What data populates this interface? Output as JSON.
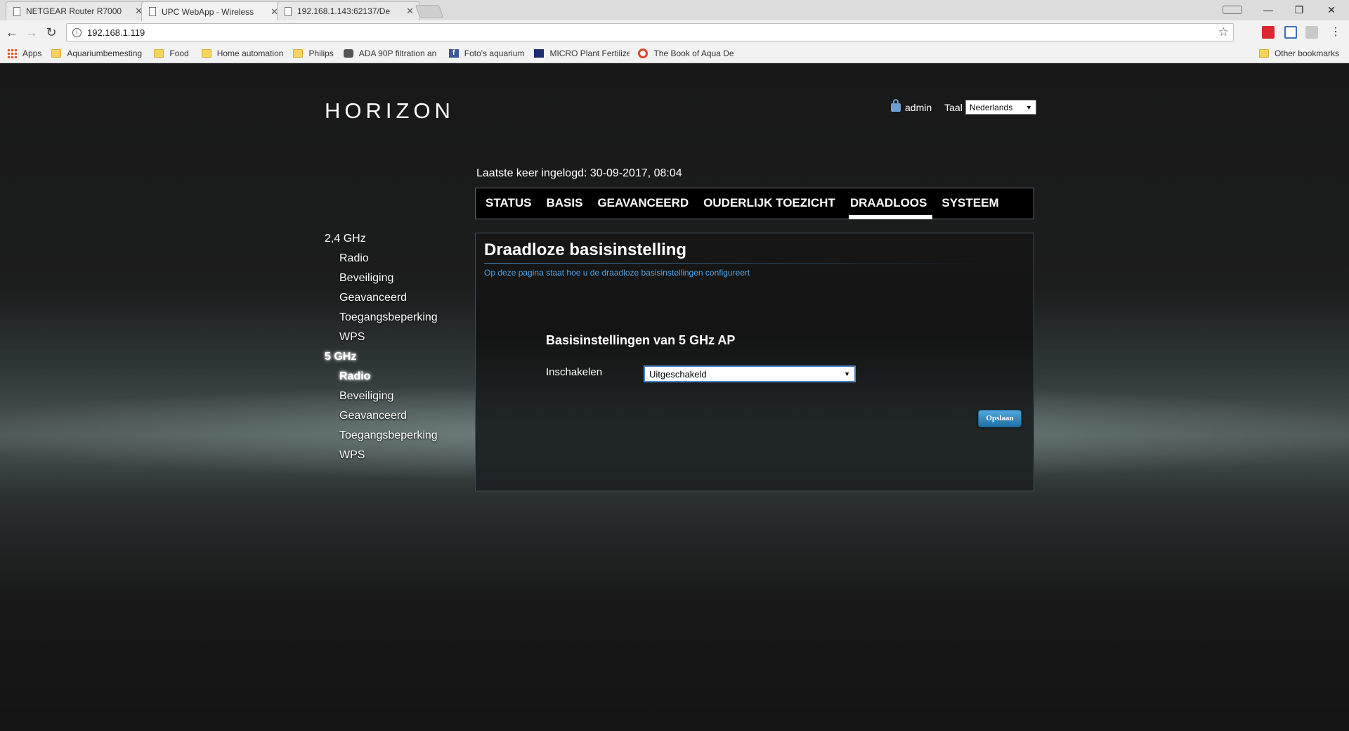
{
  "browser": {
    "tabs": [
      {
        "title": "NETGEAR Router R7000"
      },
      {
        "title": "UPC WebApp - Wireless"
      },
      {
        "title": "192.168.1.143:62137/De"
      }
    ],
    "url": "192.168.1.119",
    "bookmarks": [
      {
        "label": "Apps",
        "icon": "apps-grid-icon"
      },
      {
        "label": "Aquariumbemesting",
        "icon": "folder-icon"
      },
      {
        "label": "Food",
        "icon": "folder-icon"
      },
      {
        "label": "Home automation",
        "icon": "folder-icon"
      },
      {
        "label": "Philips",
        "icon": "folder-icon"
      },
      {
        "label": "ADA 90P filtration an",
        "icon": "ada-icon"
      },
      {
        "label": "Foto's aquarium",
        "icon": "facebook-icon"
      },
      {
        "label": "MICRO Plant Fertilize",
        "icon": "micro-icon"
      },
      {
        "label": "The Book of Aqua De",
        "icon": "book-icon"
      }
    ],
    "other_bookmarks": "Other bookmarks"
  },
  "header": {
    "logo": "HORIZON",
    "user": "admin",
    "language_label": "Taal",
    "language_value": "Nederlands"
  },
  "last_login": "Laatste keer ingelogd: 30-09-2017, 08:04",
  "topnav": {
    "items": [
      "STATUS",
      "BASIS",
      "GEAVANCEERD",
      "OUDERLIJK TOEZICHT",
      "DRAADLOOS",
      "SYSTEEM"
    ],
    "active": "DRAADLOOS"
  },
  "sidenav": {
    "groups": [
      {
        "label": "2,4 GHz",
        "items": [
          "Radio",
          "Beveiliging",
          "Geavanceerd",
          "Toegangsbeperking",
          "WPS"
        ]
      },
      {
        "label": "5 GHz",
        "items": [
          "Radio",
          "Beveiliging",
          "Geavanceerd",
          "Toegangsbeperking",
          "WPS"
        ]
      }
    ],
    "selected": "5 GHz / Radio"
  },
  "content": {
    "title": "Draadloze basisinstelling",
    "description": "Op deze pagina staat hoe u de draadloze basisinstellingen configureert",
    "section_title": "Basisinstellingen van 5 GHz AP",
    "enable_label": "Inschakelen",
    "enable_value": "Uitgeschakeld",
    "save_label": "Opslaan"
  },
  "colors": {
    "accent_blue": "#4da3e6",
    "save_button": "#2d8ac4"
  }
}
